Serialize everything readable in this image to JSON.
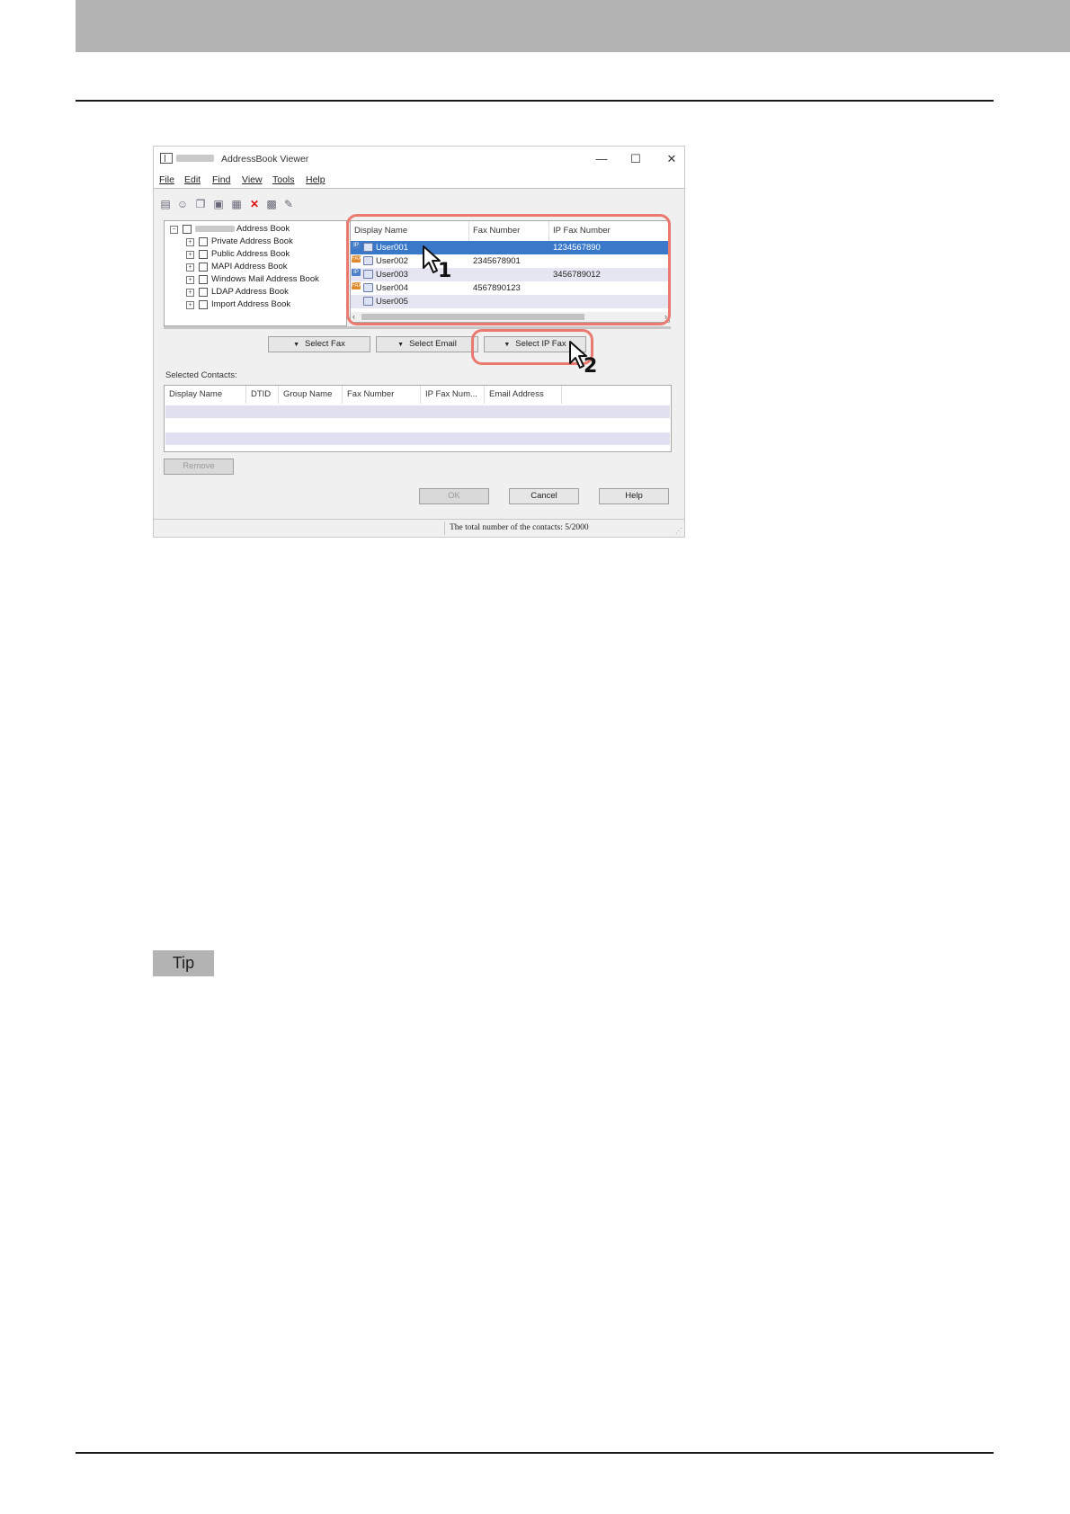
{
  "window": {
    "title": "AddressBook Viewer",
    "controls": {
      "minimize": "—",
      "maximize": "☐",
      "close": "✕"
    }
  },
  "menu": [
    "File",
    "Edit",
    "Find",
    "View",
    "Tools",
    "Help"
  ],
  "toolbar_icons": [
    "new-contact-icon",
    "new-group-icon",
    "copy-icon",
    "paste-icon",
    "properties-icon",
    "delete-icon",
    "import-icon",
    "export-icon"
  ],
  "tree": {
    "root_label": "Address Book",
    "children": [
      "Private Address Book",
      "Public Address Book",
      "MAPI Address Book",
      "Windows Mail Address Book",
      "LDAP Address Book",
      "Import Address Book"
    ]
  },
  "contacts": {
    "columns": [
      "Display Name",
      "Fax Number",
      "IP Fax Number"
    ],
    "rows": [
      {
        "name": "User001",
        "badge": "IP",
        "fax": "",
        "ip_fax": "1234567890"
      },
      {
        "name": "User002",
        "badge": "FAX",
        "fax": "2345678901",
        "ip_fax": ""
      },
      {
        "name": "User003",
        "badge": "IP",
        "fax": "",
        "ip_fax": "3456789012"
      },
      {
        "name": "User004",
        "badge": "FAX",
        "fax": "4567890123",
        "ip_fax": ""
      },
      {
        "name": "User005",
        "badge": "",
        "fax": "",
        "ip_fax": ""
      }
    ],
    "scroll_left": "‹",
    "scroll_right": "›"
  },
  "select_buttons": {
    "fax": "Select Fax",
    "email": "Select Email",
    "ip_fax": "Select IP Fax",
    "arrow": "▼"
  },
  "selected_contacts": {
    "label": "Selected Contacts:",
    "columns": [
      "Display Name",
      "DTID",
      "Group Name",
      "Fax Number",
      "IP Fax Num...",
      "Email Address"
    ]
  },
  "buttons": {
    "remove": "Remove",
    "ok": "OK",
    "cancel": "Cancel",
    "help": "Help"
  },
  "status": "The total number of the contacts: 5/2000",
  "steps": [
    "1",
    "2"
  ],
  "tip": "Tip",
  "colors": {
    "callout": "#ea7a70",
    "selection": "#3a79c9",
    "header_bar": "#b3b3b3"
  }
}
